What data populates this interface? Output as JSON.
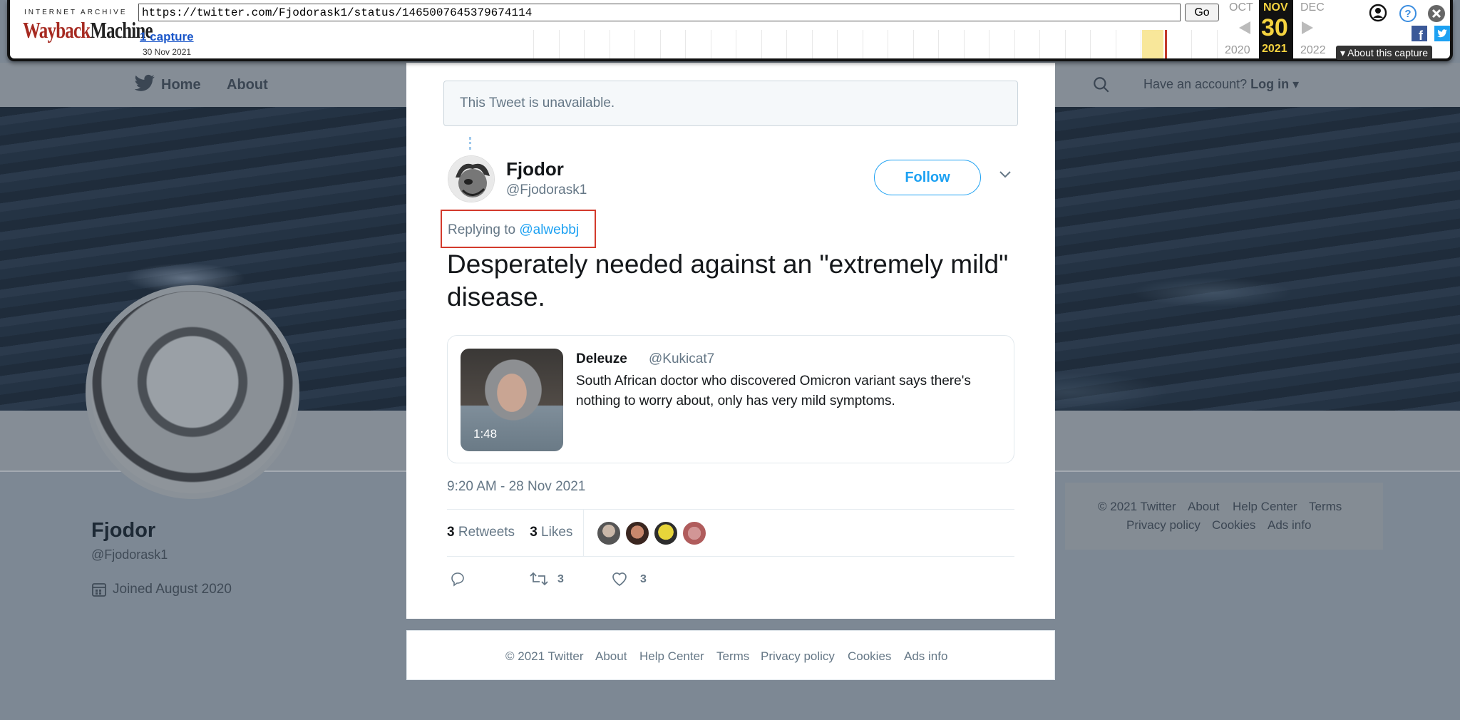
{
  "background": {
    "nav": {
      "home_label": "Home",
      "about_label": "About",
      "account_prompt": "Have an account?",
      "login_label": "Log in"
    },
    "profile": {
      "name": "Fjodor",
      "handle": "@Fjodorask1",
      "joined": "Joined August 2020"
    },
    "footer": {
      "row1": [
        "© 2021 Twitter",
        "About",
        "Help Center",
        "Terms"
      ],
      "row2": [
        "Privacy policy",
        "Cookies",
        "Ads info"
      ]
    }
  },
  "wayback": {
    "logo_top": "INTERNET ARCHIVE",
    "logo_part1": "Wayback",
    "logo_part2": "Machine",
    "url": "https://twitter.com/Fjodorask1/status/1465007645379674114",
    "go_label": "Go",
    "captures_label": "1 capture",
    "capture_date": "30 Nov 2021",
    "prev_month": "OCT",
    "cur_month": "NOV",
    "next_month": "DEC",
    "cur_day": "30",
    "prev_year": "2020",
    "cur_year": "2021",
    "next_year": "2022",
    "about_capture": "About this capture"
  },
  "tweet": {
    "unavailable_notice": "This Tweet is unavailable.",
    "author_name": "Fjodor",
    "author_handle": "@Fjodorask1",
    "follow_label": "Follow",
    "replying_prefix": "Replying to",
    "replying_to": "@alwebbj",
    "text": "Desperately needed against an \"extremely mild\" disease.",
    "quote": {
      "name": "Deleuze",
      "handle": "@Kukicat7",
      "text": "South African doctor who discovered Omicron variant says there's nothing to worry about, only has very mild symptoms.",
      "duration": "1:48"
    },
    "timestamp": "9:20 AM - 28 Nov 2021",
    "retweets_count": "3",
    "retweets_label": "Retweets",
    "likes_count": "3",
    "likes_label": "Likes",
    "action_retweet_count": "3",
    "action_like_count": "3",
    "colors": {
      "accent": "#1da1f2",
      "highlight_box": "#d33a2c"
    }
  },
  "modal_footer": [
    "© 2021 Twitter",
    "About",
    "Help Center",
    "Terms",
    "Privacy policy",
    "Cookies",
    "Ads info"
  ]
}
